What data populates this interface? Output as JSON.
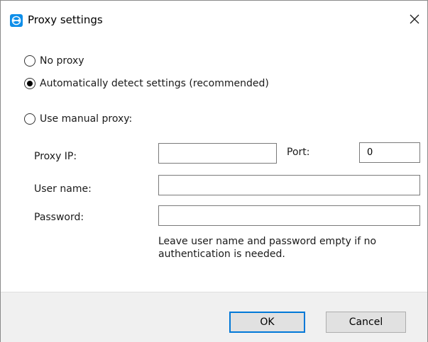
{
  "window": {
    "title": "Proxy settings",
    "app_icon": "teamviewer-icon",
    "close_icon": "close-icon"
  },
  "proxy_mode": {
    "options": [
      {
        "label": "No proxy",
        "selected": false
      },
      {
        "label": "Automatically detect settings (recommended)",
        "selected": true
      },
      {
        "label": "Use manual proxy:",
        "selected": false
      }
    ]
  },
  "manual": {
    "proxy_ip_label": "Proxy IP:",
    "proxy_ip_value": "",
    "port_label": "Port:",
    "port_value": "0",
    "username_label": "User name:",
    "username_value": "",
    "password_label": "Password:",
    "password_value": "",
    "hint": "Leave user name and password empty if no authentication is needed."
  },
  "buttons": {
    "ok_label": "OK",
    "cancel_label": "Cancel"
  },
  "colors": {
    "accent": "#0078d7",
    "icon_blue": "#0e8ee9",
    "footer_bg": "#f0f0f0",
    "button_bg": "#e1e1e1"
  }
}
